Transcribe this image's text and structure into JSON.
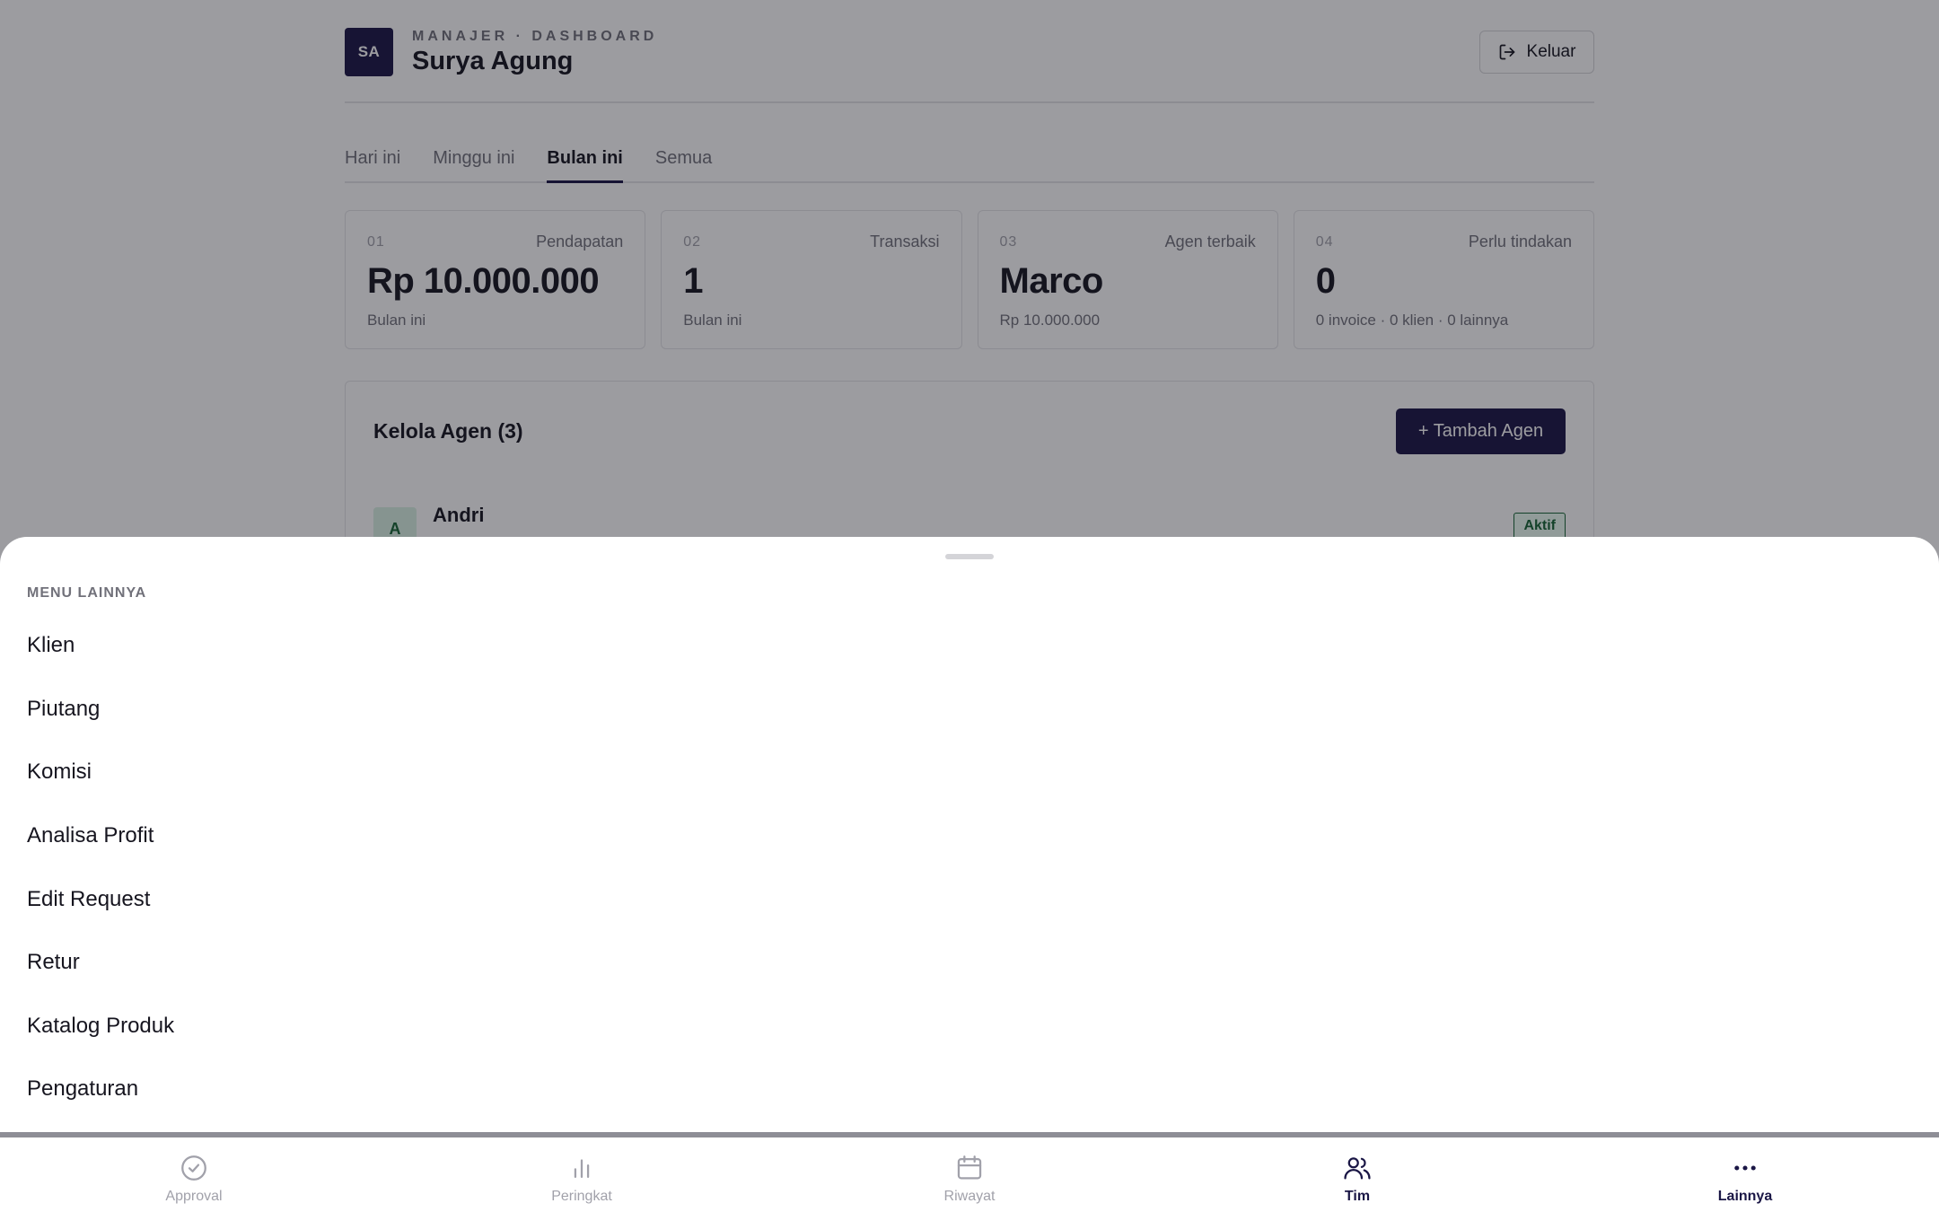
{
  "header": {
    "avatar_initials": "SA",
    "eyebrow": "MANAJER · DASHBOARD",
    "user_name": "Surya Agung",
    "logout_label": "Keluar"
  },
  "tabs": [
    {
      "label": "Hari ini",
      "active": false
    },
    {
      "label": "Minggu ini",
      "active": false
    },
    {
      "label": "Bulan ini",
      "active": true
    },
    {
      "label": "Semua",
      "active": false
    }
  ],
  "stats": [
    {
      "num": "01",
      "label": "Pendapatan",
      "value": "Rp 10.000.000",
      "sub": "Bulan ini"
    },
    {
      "num": "02",
      "label": "Transaksi",
      "value": "1",
      "sub": "Bulan ini"
    },
    {
      "num": "03",
      "label": "Agen terbaik",
      "value": "Marco",
      "sub": "Rp 10.000.000"
    },
    {
      "num": "04",
      "label": "Perlu tindakan",
      "value": "0",
      "sub": "0 invoice · 0 klien · 0 lainnya"
    }
  ],
  "agents": {
    "title": "Kelola Agen (3)",
    "add_label": "+ Tambah Agen",
    "first": {
      "initial": "A",
      "name": "Andri",
      "badge": "Aktif"
    }
  },
  "sheet": {
    "heading": "MENU LAINNYA",
    "items": [
      "Klien",
      "Piutang",
      "Komisi",
      "Analisa Profit",
      "Edit Request",
      "Retur",
      "Katalog Produk",
      "Pengaturan"
    ]
  },
  "nav": [
    {
      "label": "Approval",
      "icon": "check-circle-icon",
      "active": false
    },
    {
      "label": "Peringkat",
      "icon": "bar-chart-icon",
      "active": false
    },
    {
      "label": "Riwayat",
      "icon": "calendar-icon",
      "active": false
    },
    {
      "label": "Tim",
      "icon": "users-icon",
      "active": true
    },
    {
      "label": "Lainnya",
      "icon": "more-icon",
      "active": true
    }
  ],
  "colors": {
    "brand": "#1a1645",
    "success": "#166534",
    "muted": "#71717a"
  }
}
